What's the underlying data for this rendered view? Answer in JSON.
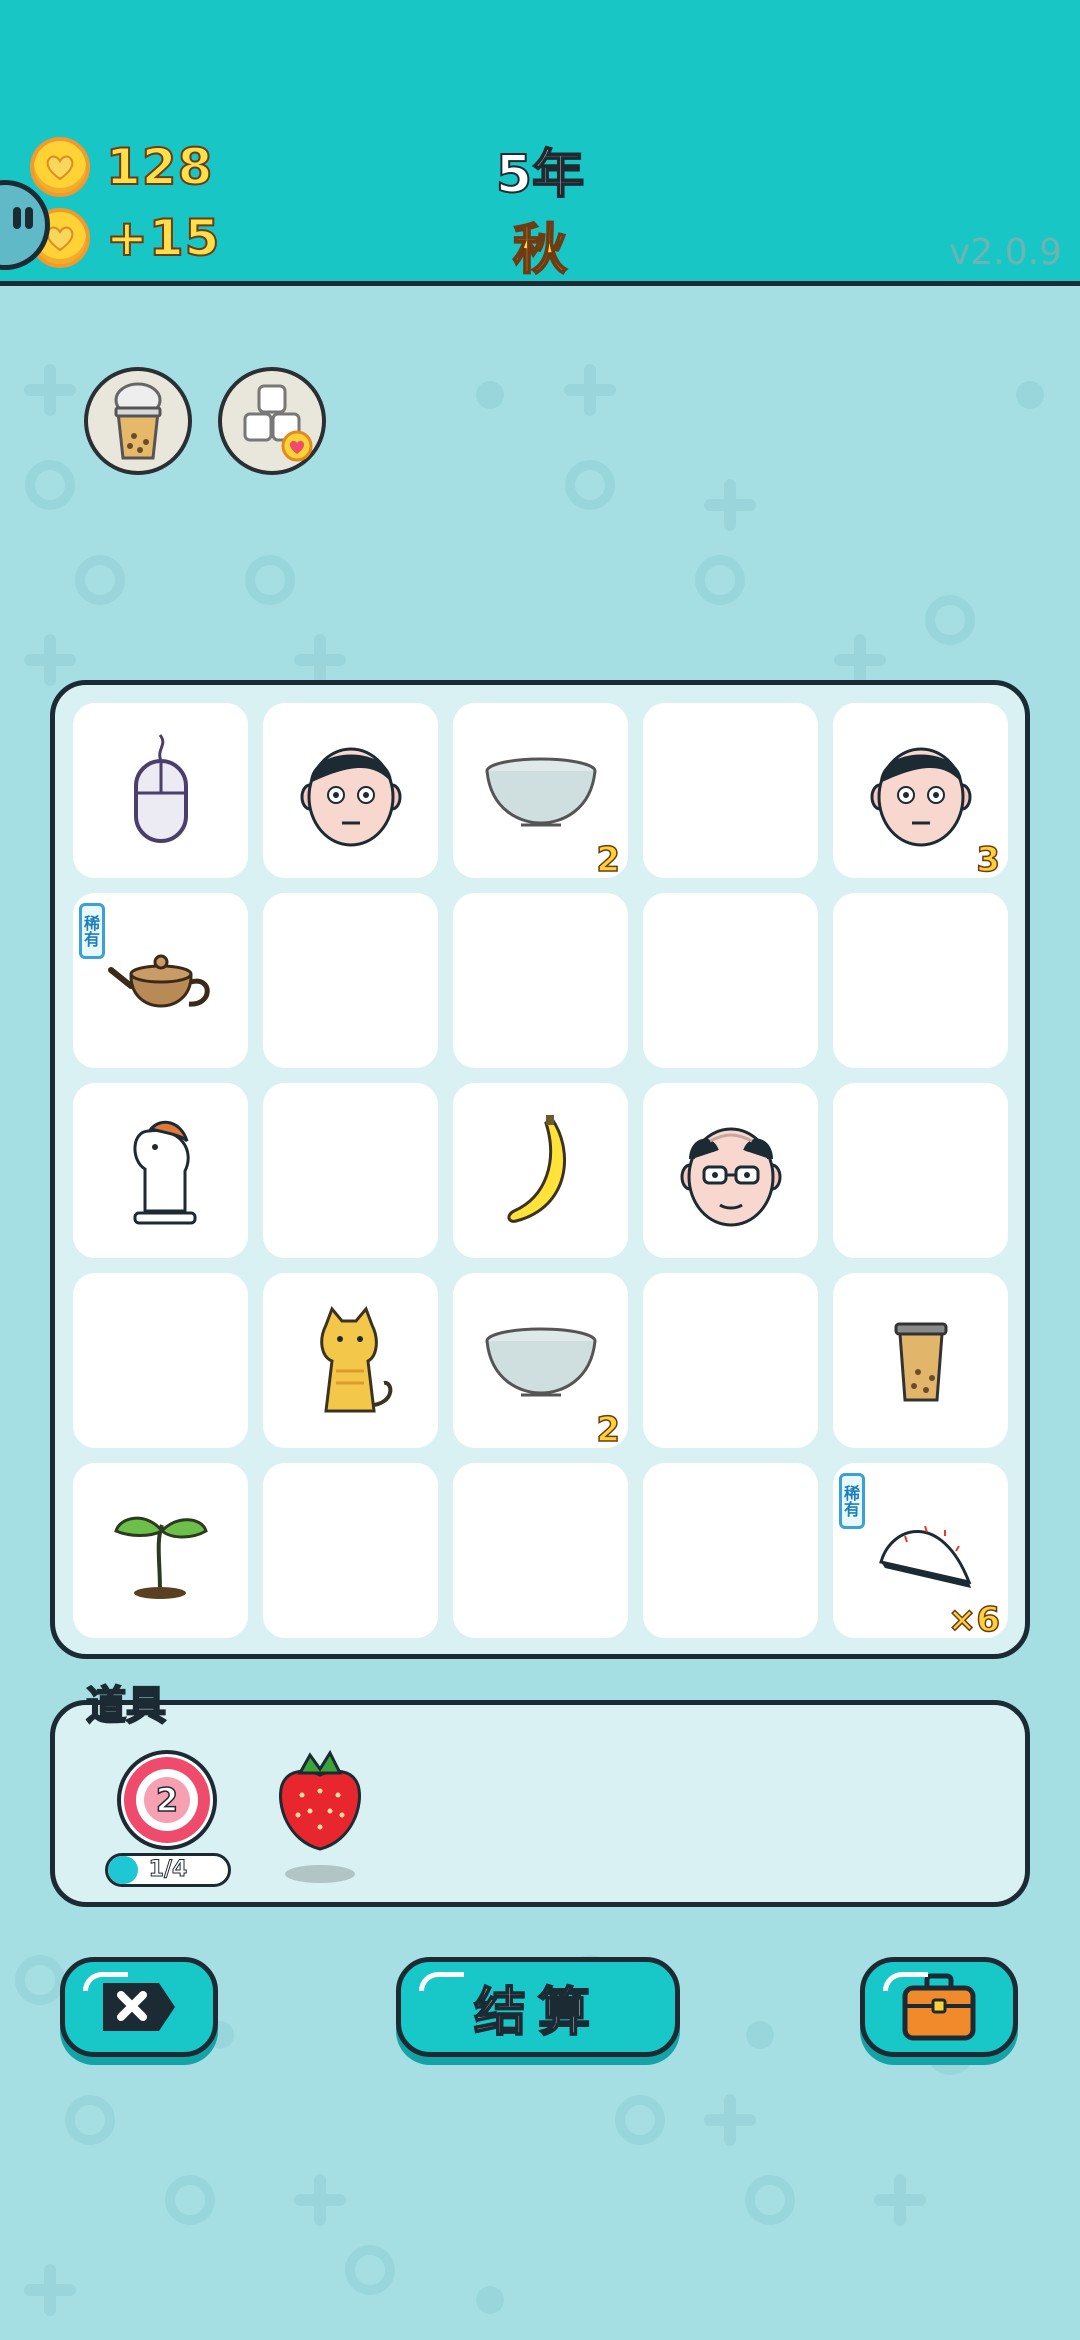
{
  "header": {
    "hearts_total": "128",
    "hearts_gain": "+15",
    "year": "5年",
    "season": "秋",
    "version": "v2.0.9"
  },
  "effects": [
    {
      "icon": "bubble-tea-icon"
    },
    {
      "icon": "sugar-cubes-heart-icon"
    }
  ],
  "board": {
    "rare_label": "稀有",
    "cells": [
      {
        "item": "computer-mouse",
        "count": ""
      },
      {
        "item": "man-face",
        "count": ""
      },
      {
        "item": "bowl",
        "count": "2"
      },
      {
        "item": "",
        "count": ""
      },
      {
        "item": "man-face",
        "count": "3"
      },
      {
        "item": "teapot",
        "count": "",
        "rare": true
      },
      {
        "item": "",
        "count": ""
      },
      {
        "item": "",
        "count": ""
      },
      {
        "item": "",
        "count": ""
      },
      {
        "item": "",
        "count": ""
      },
      {
        "item": "horse-toy",
        "count": ""
      },
      {
        "item": "",
        "count": ""
      },
      {
        "item": "banana",
        "count": ""
      },
      {
        "item": "old-man-face",
        "count": ""
      },
      {
        "item": "",
        "count": ""
      },
      {
        "item": "",
        "count": ""
      },
      {
        "item": "cat",
        "count": ""
      },
      {
        "item": "bowl",
        "count": "2"
      },
      {
        "item": "",
        "count": ""
      },
      {
        "item": "bubble-tea",
        "count": ""
      },
      {
        "item": "sprout",
        "count": ""
      },
      {
        "item": "",
        "count": ""
      },
      {
        "item": "",
        "count": ""
      },
      {
        "item": "",
        "count": ""
      },
      {
        "item": "folding-fan",
        "count": "×6",
        "rare": true
      }
    ]
  },
  "tools": {
    "title": "道具",
    "target_count": "2",
    "progress_text": "1/4",
    "progress_fraction": 0.25
  },
  "buttons": {
    "settle_label": "结算"
  },
  "colors": {
    "header": "#18c6c6",
    "background": "#a6dfe3",
    "coin_text": "#ffe04a",
    "count_text": "#ffd23a",
    "button": "#18c8c9"
  }
}
